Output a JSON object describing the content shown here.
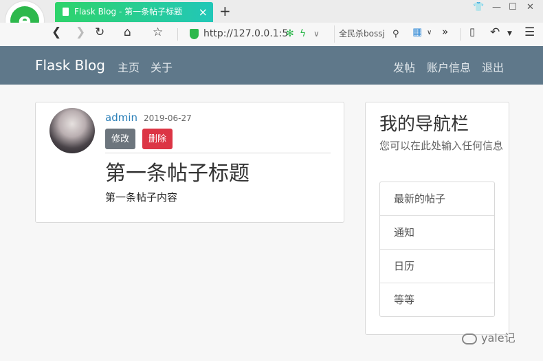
{
  "browser": {
    "tab_title": "Flask Blog - 第一条帖子标题",
    "new_tab": "+",
    "url": "http://127.0.0.1:5",
    "search": "全民杀bossj",
    "more": "»"
  },
  "navbar": {
    "brand": "Flask Blog",
    "left_links": [
      "主页",
      "关于"
    ],
    "right_links": [
      "发帖",
      "账户信息",
      "退出"
    ]
  },
  "post": {
    "author": "admin",
    "date": "2019-06-27",
    "edit_label": "修改",
    "delete_label": "删除",
    "title": "第一条帖子标题",
    "content": "第一条帖子内容"
  },
  "sidebar": {
    "title": "我的导航栏",
    "description": "您可以在此处输入任何信息",
    "items": [
      "最新的帖子",
      "通知",
      "日历",
      "等等"
    ]
  },
  "watermark": "yale记",
  "colors": {
    "navbar": "#5f788a",
    "link": "#2a7fb8",
    "edit_button": "#6c757d",
    "delete_button": "#dc3545",
    "tab": "#2ed36a"
  }
}
